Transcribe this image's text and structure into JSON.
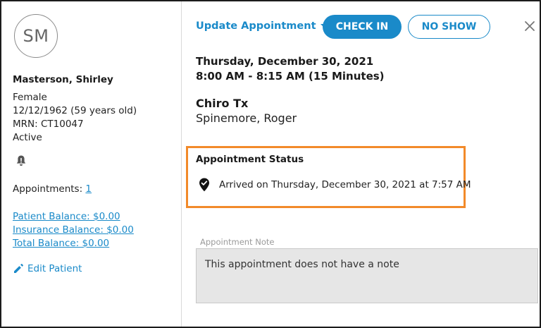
{
  "patient": {
    "initials": "SM",
    "name": "Masterson, Shirley",
    "gender": "Female",
    "dob": "12/12/1962 (59 years old)",
    "mrn": "MRN: CT10047",
    "status": "Active",
    "appointments_label": "Appointments: ",
    "appointments_count": "1",
    "patient_balance": "Patient Balance: $0.00",
    "insurance_balance": "Insurance Balance: $0.00",
    "total_balance": "Total Balance: $0.00",
    "edit_label": "Edit Patient"
  },
  "toolbar": {
    "update_label": "Update Appointment",
    "checkin_label": "CHECK IN",
    "noshow_label": "NO SHOW"
  },
  "appointment": {
    "date": "Thursday, December 30, 2021",
    "time": "8:00 AM - 8:15 AM (15 Minutes)",
    "type": "Chiro Tx",
    "provider": "Spinemore, Roger",
    "status_title": "Appointment Status",
    "status_text": "Arrived on Thursday, December 30, 2021 at 7:57 AM",
    "note_label": "Appointment Note",
    "note_text": "This appointment does not have a note"
  },
  "icons": {
    "bell": "bell-icon",
    "pencil": "pencil-icon",
    "close": "close-icon",
    "arrived": "location-check-icon",
    "caret": "caret-down-icon"
  },
  "colors": {
    "accent": "#1a8ac9",
    "highlight": "#f28a2a"
  }
}
